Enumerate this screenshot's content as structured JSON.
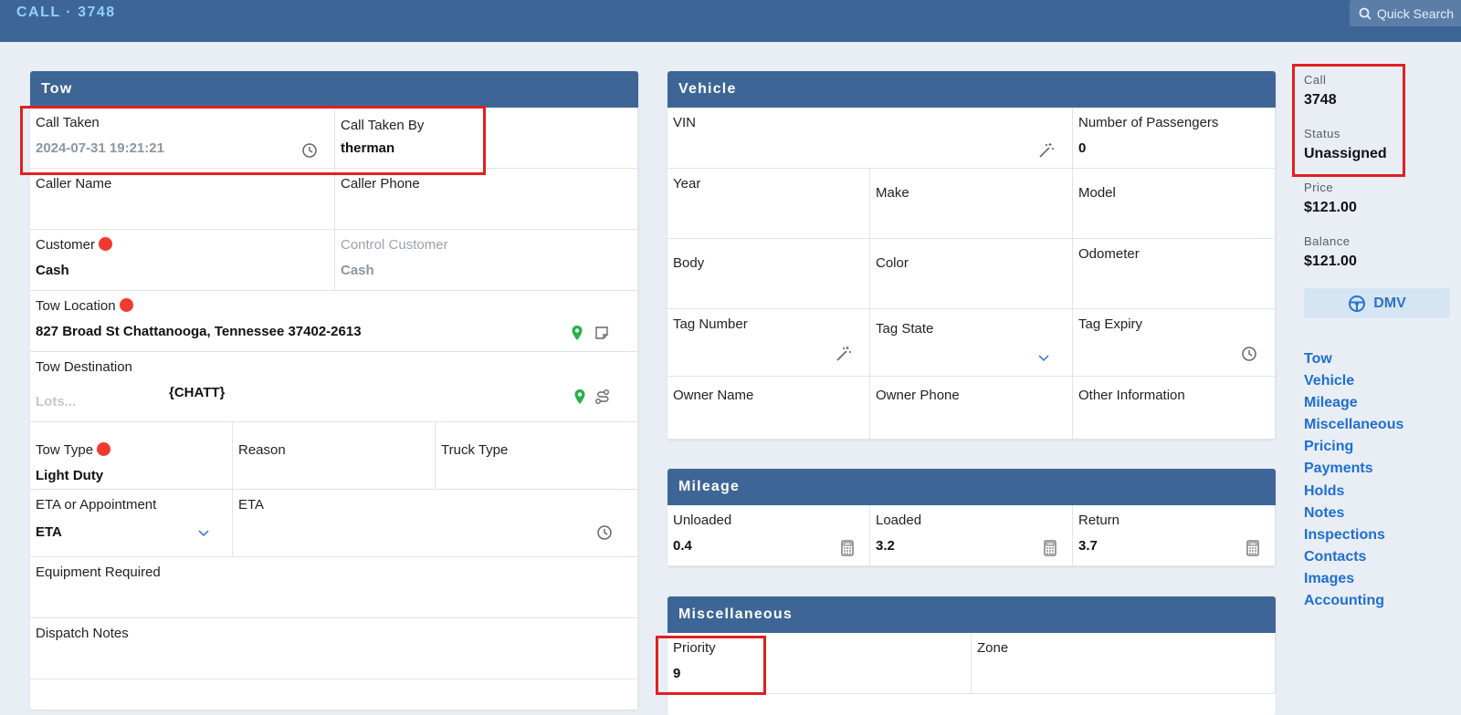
{
  "app": {
    "title": "CALL · 3748",
    "quick_search": "Quick Search"
  },
  "tow": {
    "header": "Tow",
    "call_taken": {
      "label": "Call Taken",
      "value": "2024-07-31 19:21:21"
    },
    "call_taken_by": {
      "label": "Call Taken By",
      "value": "therman"
    },
    "caller_name": {
      "label": "Caller Name",
      "value": ""
    },
    "caller_phone": {
      "label": "Caller Phone",
      "value": ""
    },
    "customer": {
      "label": "Customer",
      "value": "Cash"
    },
    "control_customer": {
      "label": "Control Customer",
      "value": "Cash"
    },
    "tow_location": {
      "label": "Tow Location",
      "value": "827 Broad St Chattanooga, Tennessee 37402-2613"
    },
    "tow_destination": {
      "label": "Tow Destination",
      "placeholder": "Lots...",
      "value": "{CHATT}"
    },
    "tow_type": {
      "label": "Tow Type",
      "value": "Light Duty"
    },
    "reason": {
      "label": "Reason",
      "value": ""
    },
    "truck_type": {
      "label": "Truck Type",
      "value": ""
    },
    "eta_or_appointment": {
      "label": "ETA or Appointment",
      "value": "ETA"
    },
    "eta": {
      "label": "ETA",
      "value": ""
    },
    "equipment_required": {
      "label": "Equipment Required",
      "value": ""
    },
    "dispatch_notes": {
      "label": "Dispatch Notes",
      "value": ""
    }
  },
  "vehicle": {
    "header": "Vehicle",
    "vin": {
      "label": "VIN",
      "value": ""
    },
    "passengers": {
      "label": "Number of Passengers",
      "value": "0"
    },
    "year": {
      "label": "Year"
    },
    "make": {
      "label": "Make"
    },
    "model": {
      "label": "Model"
    },
    "body": {
      "label": "Body"
    },
    "color": {
      "label": "Color"
    },
    "odometer": {
      "label": "Odometer"
    },
    "tag_number": {
      "label": "Tag Number"
    },
    "tag_state": {
      "label": "Tag State"
    },
    "tag_expiry": {
      "label": "Tag Expiry"
    },
    "owner_name": {
      "label": "Owner Name"
    },
    "owner_phone": {
      "label": "Owner Phone"
    },
    "other_information": {
      "label": "Other Information"
    }
  },
  "mileage": {
    "header": "Mileage",
    "unloaded": {
      "label": "Unloaded",
      "value": "0.4"
    },
    "loaded": {
      "label": "Loaded",
      "value": "3.2"
    },
    "return": {
      "label": "Return",
      "value": "3.7"
    }
  },
  "misc": {
    "header": "Miscellaneous",
    "priority": {
      "label": "Priority",
      "value": "9"
    },
    "zone": {
      "label": "Zone",
      "value": ""
    }
  },
  "summary": {
    "call_label": "Call",
    "call_value": "3748",
    "status_label": "Status",
    "status_value": "Unassigned",
    "price_label": "Price",
    "price_value": "$121.00",
    "balance_label": "Balance",
    "balance_value": "$121.00",
    "dmv_label": "DMV"
  },
  "nav": [
    "Tow",
    "Vehicle",
    "Mileage",
    "Miscellaneous",
    "Pricing",
    "Payments",
    "Holds",
    "Notes",
    "Inspections",
    "Contacts",
    "Images",
    "Accounting"
  ],
  "colors": {
    "header_blue": "#3d6696",
    "link_blue": "#1e6fd0",
    "required_red": "#f03a2e",
    "highlight_red": "#e02020"
  }
}
